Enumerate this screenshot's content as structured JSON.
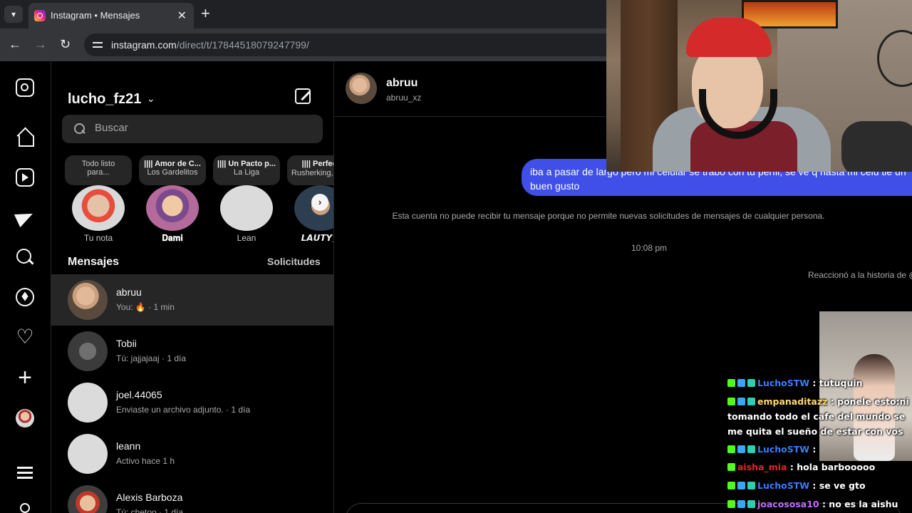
{
  "browser": {
    "menu_icon": "chevron-down-icon",
    "tab_title": "Instagram • Mensajes",
    "close_glyph": "✕",
    "new_tab_glyph": "+",
    "url_host": "instagram.com",
    "url_path": "/direct/t/17844518079247799/"
  },
  "sidebar": {
    "icons": [
      "instagram-icon",
      "home-icon",
      "reels-icon",
      "messages-icon",
      "search-icon",
      "explore-icon",
      "notifications-icon",
      "create-icon",
      "profile-avatar",
      "menu-icon",
      "more-icon"
    ]
  },
  "inbox": {
    "username": "lucho_fz21",
    "username_chevron": "⌄",
    "search_placeholder": "Buscar",
    "notes": [
      {
        "line1": "Todo listo",
        "line2": "para...",
        "name": "Tu nota"
      },
      {
        "line1": "|||| Amor de C...",
        "line2": "Los Gardelitos",
        "name": "𝐃𝐚𝐦𝐢"
      },
      {
        "line1": "|||| Un Pacto p...",
        "line2": "La Liga",
        "name": "Lean"
      },
      {
        "line1": "|||| Perfect",
        "line2": "Rusherking, A💗",
        "name": "𝙇𝘼𝙐𝙏𝙔_𝙅"
      }
    ],
    "notes_next": "›",
    "messages_header": "Mensajes",
    "requests_label": "Solicitudes",
    "conversations": [
      {
        "name": "abruu",
        "preview": "You: 🔥 · 1 min"
      },
      {
        "name": "Tobii",
        "preview": "Tú: jajjajaaj · 1 día"
      },
      {
        "name": "joel.44065",
        "preview": "Enviaste un archivo adjunto. · 1 día"
      },
      {
        "name": "leann",
        "preview": "Activo hace 1 h"
      },
      {
        "name": "Alexis Barboza",
        "preview": "Tú: chetoo · 1 día"
      }
    ]
  },
  "chat": {
    "name": "abruu",
    "handle": "abruu_xz",
    "outgoing_message": "iba a pasar de largo pero mi celular se trabó con tu perfil, se ve q hasta mi celu tie un buen gusto",
    "system_message": "Esta cuenta no puede recibir tu mensaje porque no permite nuevas solicitudes de mensajes de cualquier persona.",
    "timestamp": "10:08 pm",
    "story_reply": "Reaccionó a la historia de @"
  },
  "stream_chat": [
    {
      "user": "LuchoSTW",
      "text": " : tutuquin",
      "color": "u-blue",
      "badges": [
        "k",
        "sub",
        "cam"
      ]
    },
    {
      "user": "empanaditazz",
      "text": " : ponele esto:ni tomando todo el cafe del mundo se me quita el sueño de estar con vos",
      "color": "u-yellow",
      "badges": [
        "k",
        "sub",
        "cam"
      ]
    },
    {
      "user": "LuchoSTW",
      "text": " :",
      "color": "u-blue",
      "badges": [
        "k",
        "sub",
        "cam"
      ]
    },
    {
      "user": "aisha_mia",
      "text": " : hola barbooooo",
      "color": "u-red",
      "badges": [
        "k"
      ]
    },
    {
      "user": "LuchoSTW",
      "text": " : se ve gto",
      "color": "u-blue",
      "badges": [
        "k",
        "sub",
        "cam"
      ]
    },
    {
      "user": "joacososa10",
      "text": " : no es la aishu",
      "color": "u-purple",
      "badges": [
        "k",
        "sub",
        "cam"
      ]
    }
  ],
  "colors": {
    "outgoing_bubble": "#3f4fe8",
    "background": "#000000",
    "surface": "#262626",
    "kick_green": "#53fc18"
  }
}
